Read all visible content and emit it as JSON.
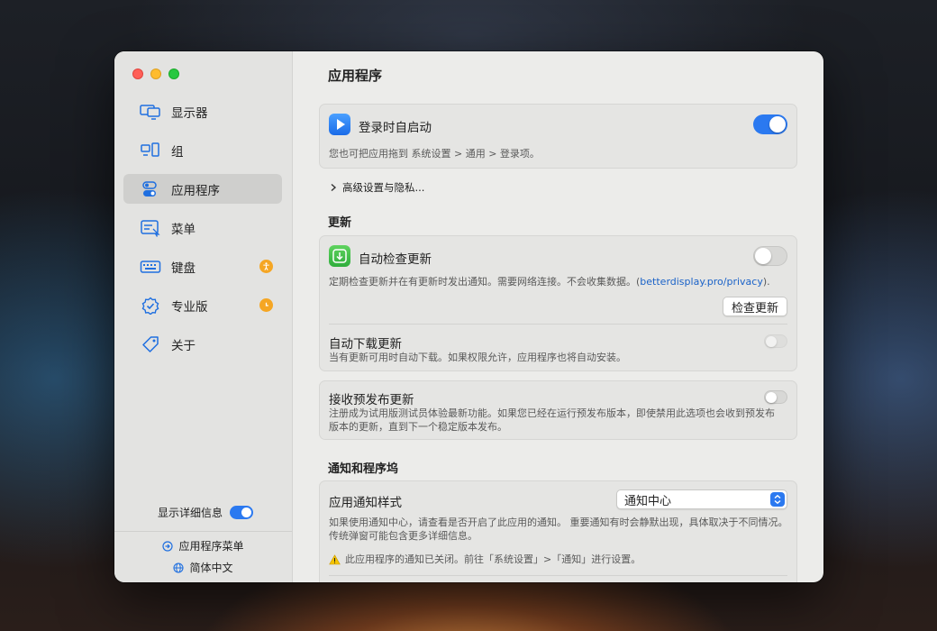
{
  "sidebar": {
    "items": [
      {
        "label": "显示器",
        "icon": "displays-icon",
        "active": false
      },
      {
        "label": "组",
        "icon": "groups-icon",
        "active": false
      },
      {
        "label": "应用程序",
        "icon": "toggles-icon",
        "active": true
      },
      {
        "label": "菜单",
        "icon": "menu-icon",
        "active": false
      },
      {
        "label": "键盘",
        "icon": "keyboard-icon",
        "active": false,
        "badge": "accessibility-icon"
      },
      {
        "label": "专业版",
        "icon": "pro-badge-icon",
        "active": false,
        "badge": "clock-icon"
      },
      {
        "label": "关于",
        "icon": "tag-icon",
        "active": false
      }
    ],
    "detail_label": "显示详细信息",
    "detail_on": true,
    "footer_menu_link": "应用程序菜单",
    "footer_language": "简体中文"
  },
  "main": {
    "title": "应用程序",
    "login": {
      "label": "登录时自启动",
      "enabled": true,
      "desc": "您也可把应用拖到 系统设置 > 通用 > 登录项。"
    },
    "advanced_label": "高级设置与隐私...",
    "updates": {
      "section_title": "更新",
      "auto_check_label": "自动检查更新",
      "auto_check_enabled": false,
      "auto_check_desc": "定期检查更新并在有更新时发出通知。需要网络连接。不会收集数据。(",
      "privacy_link": "betterdisplay.pro/privacy",
      "auto_check_desc_end": ").",
      "check_button": "检查更新",
      "auto_download_label": "自动下载更新",
      "auto_download_enabled": false,
      "auto_download_desc": "当有更新可用时自动下载。如果权限允许，应用程序也将自动安装。",
      "prerelease_label": "接收预发布更新",
      "prerelease_enabled": false,
      "prerelease_desc_1": "注册成为试用版测试员体验最新功能。如果您已经在运行预发布版本，即使禁用此选项也会收到预发布",
      "prerelease_desc_2": "版本的更新，直到下一个稳定版本发布。"
    },
    "notifications": {
      "section_title": "通知和程序坞",
      "style_label": "应用通知样式",
      "style_value": "通知中心",
      "desc_1": "如果使用通知中心，请查看是否开启了此应用的通知。 重要通知有时会静默出现，具体取决于不同情况。",
      "desc_2": "传统弹窗可能包含更多详细信息。",
      "warning": "此应用程序的通知已关闭。前往「系统设置」>「通知」进行设置。"
    }
  },
  "colors": {
    "accent": "#2b79f0",
    "badge": "#f5a623",
    "link": "#1a62c8"
  }
}
